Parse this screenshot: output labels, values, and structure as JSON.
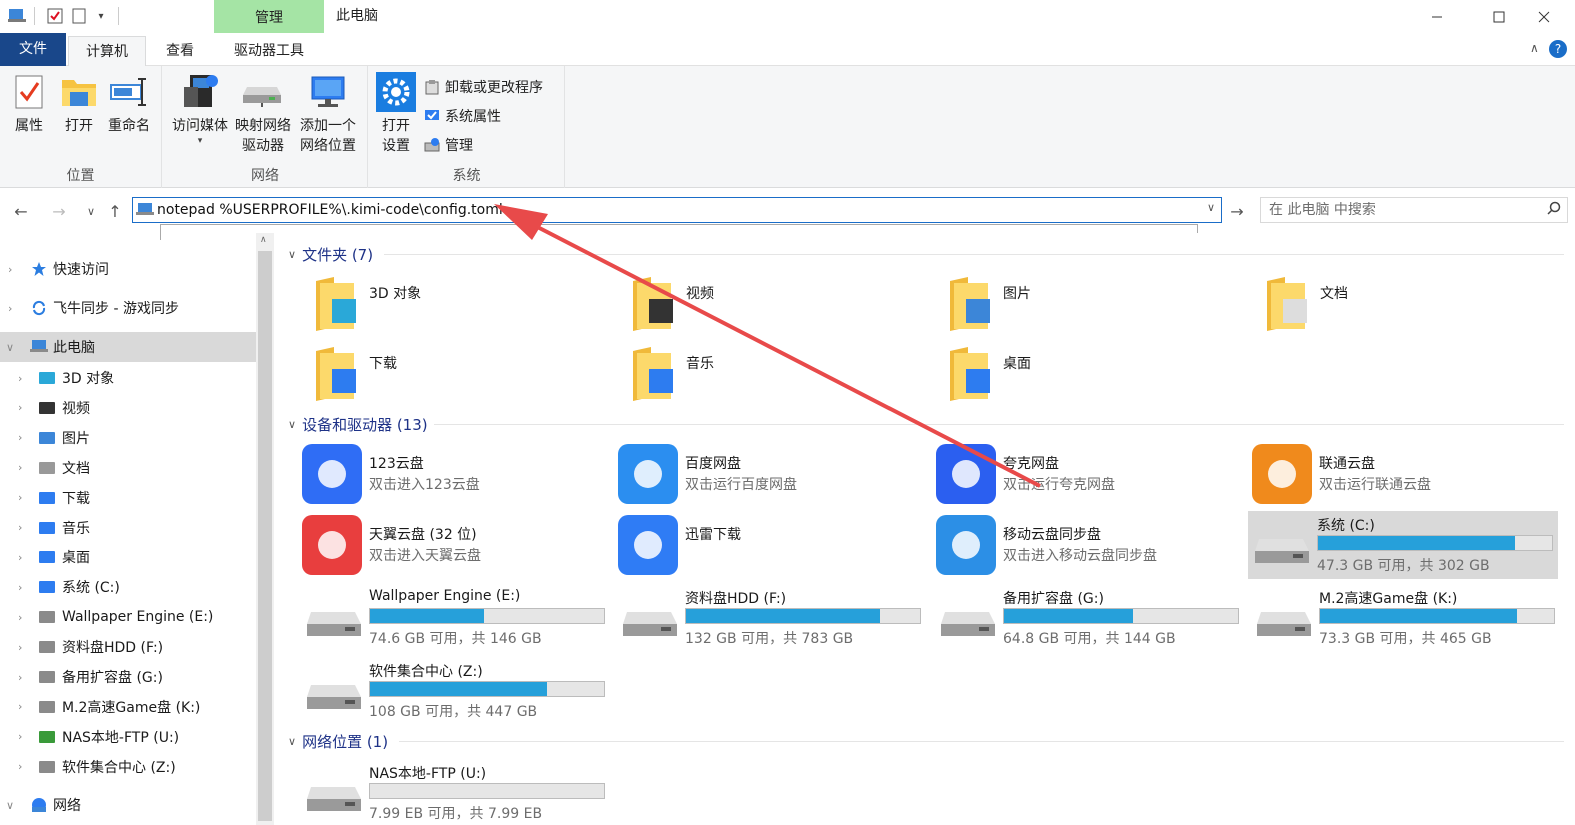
{
  "window": {
    "context_tab": "管理",
    "title": "此电脑"
  },
  "tabs": [
    {
      "label": "文件"
    },
    {
      "label": "计算机"
    },
    {
      "label": "查看"
    },
    {
      "label": "驱动器工具"
    }
  ],
  "ribbon": {
    "location_group": {
      "label": "位置",
      "buttons": [
        "属性",
        "打开",
        "重命名"
      ]
    },
    "network_group": {
      "label": "网络",
      "buttons": [
        {
          "line1": "访问媒体",
          "line2": ""
        },
        {
          "line1": "映射网络",
          "line2": "驱动器"
        },
        {
          "line1": "添加一个",
          "line2": "网络位置"
        }
      ]
    },
    "system_group": {
      "label": "系统",
      "open_settings": {
        "line1": "打开",
        "line2": "设置"
      },
      "items": [
        "卸载或更改程序",
        "系统属性",
        "管理"
      ]
    }
  },
  "address": {
    "value": "notepad %USERPROFILE%\\.kimi-code\\config.toml"
  },
  "search": {
    "placeholder": "在 此电脑 中搜索"
  },
  "nav": {
    "top_items": [
      {
        "label": "快速访问",
        "icon": "star-icon"
      },
      {
        "label": "飞牛同步 - 游戏同步",
        "icon": "sync-icon"
      },
      {
        "label": "此电脑",
        "icon": "computer-icon"
      }
    ],
    "pc_children": [
      "3D 对象",
      "视频",
      "图片",
      "文档",
      "下载",
      "音乐",
      "桌面",
      "系统 (C:)",
      "Wallpaper Engine (E:)",
      "资料盘HDD (F:)",
      "备用扩容盘 (G:)",
      "M.2高速Game盘 (K:)",
      "NAS本地-FTP (U:)",
      "软件集合中心 (Z:)"
    ],
    "network": "网络"
  },
  "sections": {
    "folders": "文件夹 (7)",
    "devices": "设备和驱动器 (13)",
    "network": "网络位置 (1)"
  },
  "folders": [
    "3D 对象",
    "视频",
    "图片",
    "文档",
    "下载",
    "音乐",
    "桌面"
  ],
  "apps": [
    {
      "name": "123云盘",
      "sub": "双击进入123云盘",
      "color": "#2f6df5"
    },
    {
      "name": "百度网盘",
      "sub": "双击运行百度网盘",
      "color": "#2b8ef0"
    },
    {
      "name": "夸克网盘",
      "sub": "双击运行夸克网盘",
      "color": "#2b5ff0"
    },
    {
      "name": "联通云盘",
      "sub": "双击运行联通云盘",
      "color": "#f08a1c"
    },
    {
      "name": "天翼云盘 (32 位)",
      "sub": "双击进入天翼云盘",
      "color": "#e83e3e"
    },
    {
      "name": "迅雷下载",
      "sub": "",
      "color": "#2f7cf5"
    },
    {
      "name": "移动云盘同步盘",
      "sub": "双击进入移动云盘同步盘",
      "color": "#2c8fe6"
    }
  ],
  "drives": [
    {
      "name": "系统 (C:)",
      "sub": "47.3 GB 可用，共 302 GB",
      "used_fraction": 0.843
    },
    {
      "name": "Wallpaper Engine (E:)",
      "sub": "74.6 GB 可用，共 146 GB",
      "used_fraction": 0.489
    },
    {
      "name": "资料盘HDD (F:)",
      "sub": "132 GB 可用，共 783 GB",
      "used_fraction": 0.831
    },
    {
      "name": "备用扩容盘 (G:)",
      "sub": "64.8 GB 可用，共 144 GB",
      "used_fraction": 0.55
    },
    {
      "name": "M.2高速Game盘 (K:)",
      "sub": "73.3 GB 可用，共 465 GB",
      "used_fraction": 0.842
    },
    {
      "name": "软件集合中心 (Z:)",
      "sub": "108 GB 可用，共 447 GB",
      "used_fraction": 0.758
    }
  ],
  "network_locations": [
    {
      "name": "NAS本地-FTP (U:)",
      "sub": "7.99 EB 可用，共 7.99 EB",
      "used_fraction": 0.0
    }
  ],
  "colors": {
    "file_tab": "#19478a",
    "context_tab": "#a5e4a5",
    "bar_fill": "#26a0da",
    "section_header": "#1e3287",
    "annotation_arrow": "#e84a4a"
  }
}
